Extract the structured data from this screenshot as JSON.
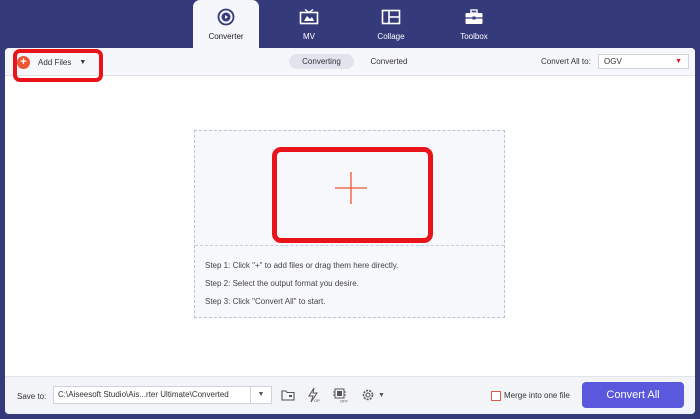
{
  "nav": {
    "tabs": [
      {
        "label": "Converter",
        "icon": "converter-icon",
        "active": true
      },
      {
        "label": "MV",
        "icon": "tv-icon",
        "active": false
      },
      {
        "label": "Collage",
        "icon": "collage-icon",
        "active": false
      },
      {
        "label": "Toolbox",
        "icon": "toolbox-icon",
        "active": false
      }
    ]
  },
  "toolbar": {
    "add_files_label": "Add Files",
    "segments": [
      "Converting",
      "Converted"
    ],
    "active_segment": "Converting",
    "convert_all_to_label": "Convert All to:",
    "format_value": "OGV"
  },
  "dropzone": {
    "steps": [
      "Step 1: Click \"+\" to add files or drag them here directly.",
      "Step 2: Select the output format you desire.",
      "Step 3: Click \"Convert All\" to start."
    ]
  },
  "bottom": {
    "save_to_label": "Save to:",
    "save_path": "C:\\Aiseesoft Studio\\Ais...rter Ultimate\\Converted",
    "merge_label": "Merge into one file",
    "merge_checked": false,
    "convert_all_label": "Convert All"
  },
  "colors": {
    "background": "#353a7a",
    "accent_red": "#e8141a",
    "plus_orange": "#ee5533",
    "convert_button": "#5a58dc"
  }
}
